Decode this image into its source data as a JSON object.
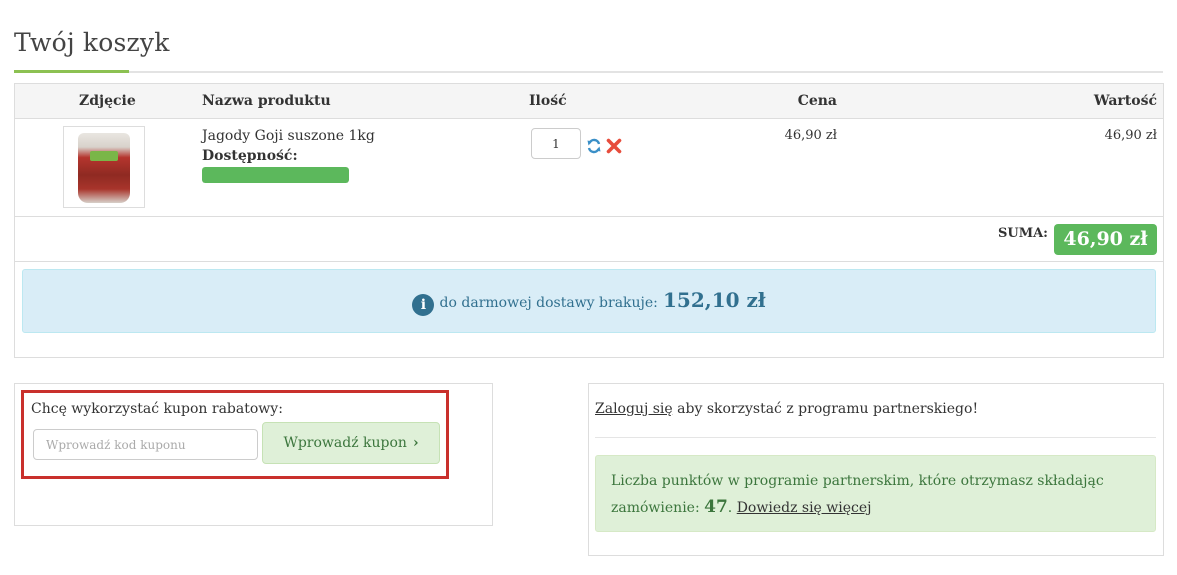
{
  "page": {
    "title": "Twój koszyk"
  },
  "cart": {
    "columns": {
      "photo": "Zdjęcie",
      "name": "Nazwa produktu",
      "qty": "Ilość",
      "price": "Cena",
      "value": "Wartość"
    },
    "items": [
      {
        "name": "Jagody Goji suszone 1kg",
        "availability_label": "Dostępność:",
        "availability_level": 1.0,
        "qty": "1",
        "price": "46,90 zł",
        "value": "46,90 zł"
      }
    ],
    "sum_label": "SUMA:",
    "sum_value": "46,90 zł"
  },
  "shipping": {
    "text": "do darmowej dostawy brakuje:",
    "amount": "152,10 zł",
    "icon": "info-icon",
    "icon_glyph": "i"
  },
  "coupon": {
    "label": "Chcę wykorzystać kupon rabatowy:",
    "placeholder": "Wprowadź kod kuponu",
    "button_label": "Wprowadź kupon",
    "button_icon": "chevron-right-icon"
  },
  "partner": {
    "login_link": "Zaloguj się",
    "login_text": " aby skorzystać z programu partnerskiego!",
    "points_text": "Liczba punktów w programie partnerskim, które otrzymasz składając zamówienie: ",
    "points_value": "47",
    "points_sep": ".",
    "more_link": "Dowiedz się więcej"
  },
  "colors": {
    "accent_green": "#8cc152",
    "sum_badge": "#5cb85c",
    "info_bg": "#d9edf7",
    "success_bg": "#dff0d8",
    "highlight_red": "#c9302c",
    "remove_red": "#e74c3c",
    "refresh_blue": "#3a8fc7"
  }
}
